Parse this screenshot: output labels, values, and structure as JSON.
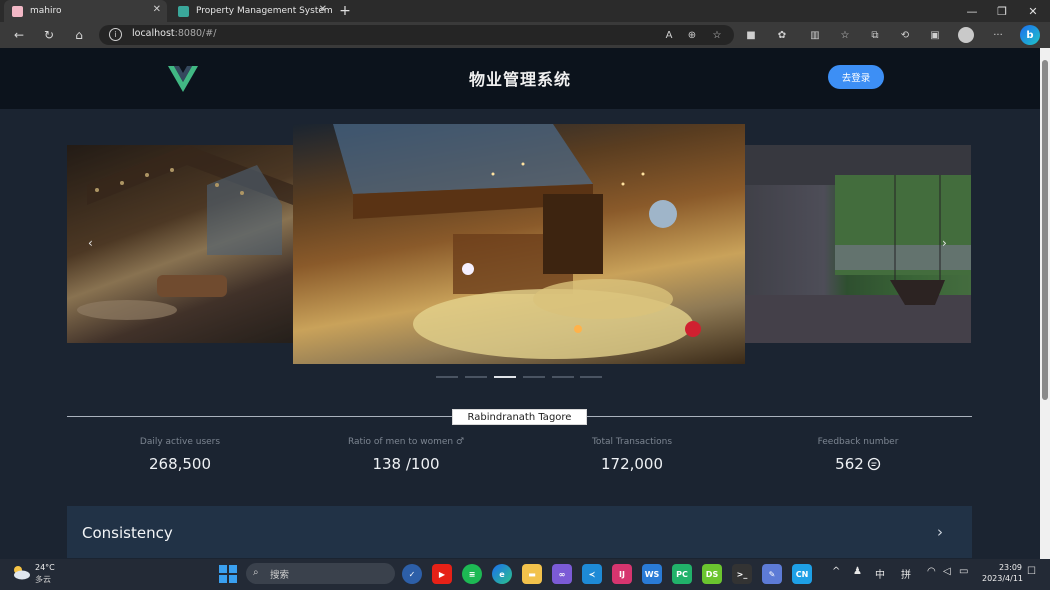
{
  "browser": {
    "tabs": [
      {
        "label": "mahiro",
        "active": true
      },
      {
        "label": "Property Management System",
        "active": false
      }
    ],
    "new_tab": "+",
    "url_host": "localhost",
    "url_path": ":8080/#/",
    "window_controls": [
      "—",
      "❐",
      "✕"
    ]
  },
  "header": {
    "logo": "vue-logo",
    "title": "物业管理系统",
    "login_label": "去登录"
  },
  "carousel": {
    "images": [
      "cozy-attic-room-left",
      "cozy-attic-bedroom-center",
      "glass-room-forest-right"
    ],
    "prev": "‹",
    "next": "›",
    "dots": 6,
    "active_dot": 2
  },
  "quote": "Rabindranath Tagore",
  "stats": [
    {
      "label": "Daily active users",
      "value": "268,500"
    },
    {
      "label": "Ratio of men to women ♂",
      "value": "138 /100"
    },
    {
      "label": "Total Transactions",
      "value": "172,000"
    },
    {
      "label": "Feedback number",
      "value": "562"
    }
  ],
  "card": {
    "title": "Consistency",
    "chevron": "›"
  },
  "taskbar": {
    "weather_temp": "24°C",
    "weather_cond": "多云",
    "search_placeholder": "搜索",
    "ime_1": "中",
    "ime_2": "拼",
    "time": "23:09",
    "date": "2023/4/11"
  },
  "colors": {
    "accent": "#3d8ff5",
    "header_bg": "#0c131c",
    "body_bg": "#1b2431",
    "card_bg": "#213246"
  }
}
